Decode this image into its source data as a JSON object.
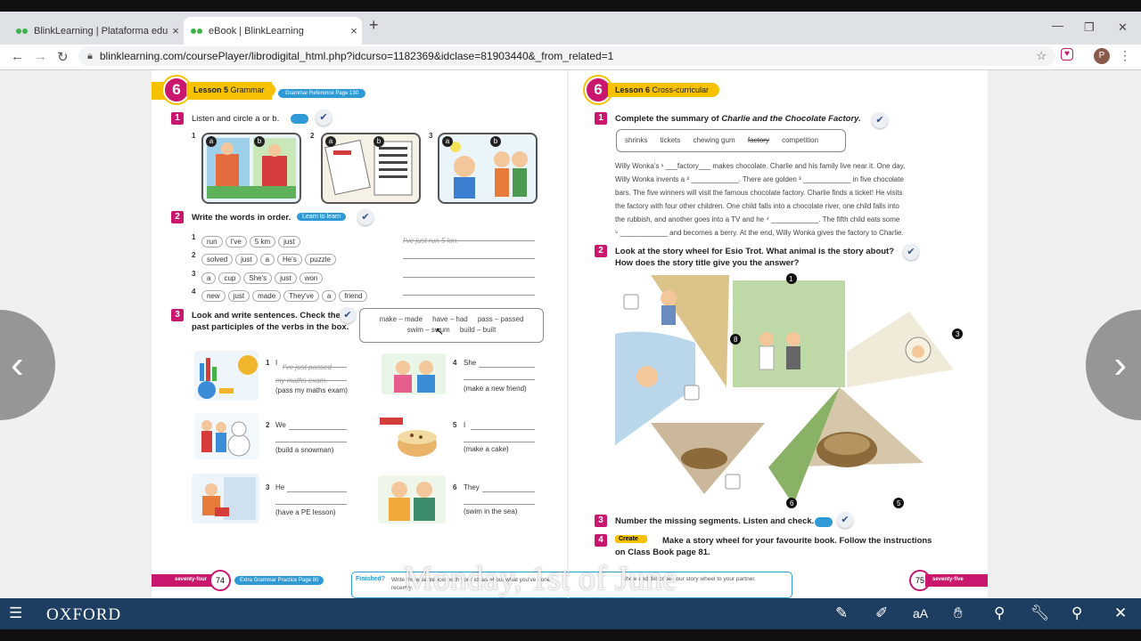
{
  "browser": {
    "tabs": [
      {
        "label": "BlinkLearning | Plataforma educa",
        "close": "×"
      },
      {
        "label": "eBook | BlinkLearning",
        "close": "×"
      }
    ],
    "new_tab": "+",
    "window_controls": [
      "—",
      "❐",
      "✕"
    ],
    "url": "blinklearning.com/coursePlayer/librodigital_html.php?idcurso=1182369&idclase=81903440&_from_related=1",
    "profile_initial": "P"
  },
  "left_page": {
    "lesson_num": "6",
    "lesson_label": "Lesson 5",
    "lesson_topic": "Grammar",
    "ref": "Grammar Reference Page 130",
    "ex1": {
      "num": "1",
      "text": "Listen and circle a or b.",
      "items": [
        "1",
        "2",
        "3"
      ],
      "opts": [
        "a",
        "b"
      ]
    },
    "ex2": {
      "num": "2",
      "text": "Write the words in order.",
      "tag": "Learn to learn",
      "rows": [
        {
          "n": "1",
          "words": [
            "run",
            "I've",
            "5 km",
            "just"
          ],
          "answer": "I've just run 5 km."
        },
        {
          "n": "2",
          "words": [
            "solved",
            "just",
            "a",
            "He's",
            "puzzle"
          ],
          "answer": ""
        },
        {
          "n": "3",
          "words": [
            "a",
            "cup",
            "She's",
            "just",
            "won"
          ],
          "answer": ""
        },
        {
          "n": "4",
          "words": [
            "new",
            "just",
            "made",
            "They've",
            "a",
            "friend"
          ],
          "answer": ""
        }
      ]
    },
    "ex3": {
      "num": "3",
      "text1": "Look and write sentences. Check the",
      "text2": "past participles of the verbs in the box.",
      "box1": "make – made     have – had     pass – passed",
      "box2": "swim – swum     build – built",
      "items": [
        {
          "n": "1",
          "start": "I",
          "answer1": "I've just passed",
          "answer2": "my maths exam.",
          "hint": "(pass my maths exam)"
        },
        {
          "n": "2",
          "start": "We",
          "hint": "(build a snowman)"
        },
        {
          "n": "3",
          "start": "He",
          "hint": "(have a PE lesson)"
        },
        {
          "n": "4",
          "start": "She",
          "hint": "(make a new friend)"
        },
        {
          "n": "5",
          "start": "I",
          "hint": "(make a cake)"
        },
        {
          "n": "6",
          "start": "They",
          "hint": "(swim in the sea)"
        }
      ]
    },
    "footer_word": "seventy-four",
    "page_num": "74",
    "footer_pill": "Extra Grammar Practice Page 80",
    "finished_label": "Finished?",
    "finished_text": "Write three sentences with your ideas about what you've done recently."
  },
  "right_page": {
    "lesson_num": "6",
    "lesson_label": "Lesson 6",
    "lesson_topic": "Cross-curricular",
    "ex1": {
      "num": "1",
      "text_a": "Complete the summary of",
      "text_b": "Charlie and the Chocolate Factory.",
      "words": [
        "shrinks",
        "tickets",
        "chewing gum",
        "factory",
        "competition"
      ],
      "para": [
        "Willy Wonka's ¹ ___factory___ makes chocolate. Charlie and his family live near it. One day,",
        "Willy Wonka invents a ² ____________. There are golden ³ ____________ in five chocolate",
        "bars. The five winners will visit the famous chocolate factory. Charlie finds a ticket! He visits",
        "the factory with four other children. One child falls into a chocolate river, one child falls into",
        "the rubbish, and another goes into a TV and he ⁴ ____________. The fifth child eats some",
        "⁵ ____________ and becomes a berry. At the end, Willy Wonka gives the factory to Charlie."
      ]
    },
    "ex2": {
      "num": "2",
      "text1": "Look at the story wheel for Esio Trot. What animal is the story about?",
      "text2": "How does the story title give you the answer?",
      "wheel_labels": [
        "1",
        "3",
        "5",
        "6",
        "8"
      ]
    },
    "ex3": {
      "num": "3",
      "text": "Number the missing segments. Listen and check."
    },
    "ex4": {
      "num": "4",
      "tag": "Create",
      "text1": "Make a story wheel for your favourite book. Follow the instructions",
      "text2": "on Class Book page 81."
    },
    "finished_text": "Show and describe your story wheel to your partner.",
    "page_num": "75",
    "footer_word": "seventy-five"
  },
  "overlay": {
    "watermark": "Monday, 1st of June",
    "prev": "‹",
    "next": "›"
  },
  "toolbar": {
    "brand": "OXFORD"
  },
  "colors": {
    "magenta": "#c8176c",
    "yellow": "#f6c200",
    "blue": "#2f9ad6",
    "toolbar": "#1d3e60"
  }
}
